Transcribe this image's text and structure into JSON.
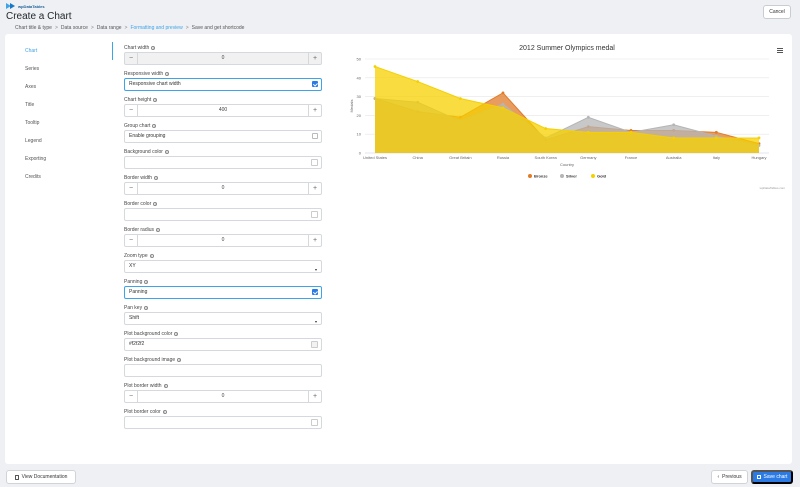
{
  "app": {
    "logo_text": "wpDataTables",
    "title": "Create a Chart",
    "cancel_label": "Cancel"
  },
  "breadcrumb": [
    {
      "label": "Chart title & type",
      "active": false
    },
    {
      "label": "Data source",
      "active": false
    },
    {
      "label": "Data range",
      "active": false
    },
    {
      "label": "Formatting and preview",
      "active": true
    },
    {
      "label": "Save and get shortcode",
      "active": false
    }
  ],
  "sidebar": {
    "items": [
      "Chart",
      "Series",
      "Axes",
      "Title",
      "Tooltip",
      "Legend",
      "Exporting",
      "Credits"
    ],
    "active_index": 0
  },
  "form": {
    "chart_width": {
      "label": "Chart width",
      "value": "0"
    },
    "responsive_width": {
      "label": "Responsive width",
      "text": "Responsive chart width",
      "checked": true
    },
    "chart_height": {
      "label": "Chart height",
      "value": "400"
    },
    "group_chart": {
      "label": "Group chart",
      "text": "Enable grouping",
      "checked": false
    },
    "background_color": {
      "label": "Background color",
      "value": ""
    },
    "border_width": {
      "label": "Border width",
      "value": "0"
    },
    "border_color": {
      "label": "Border color",
      "value": ""
    },
    "border_radius": {
      "label": "Border radius",
      "value": "0"
    },
    "zoom_type": {
      "label": "Zoom type",
      "value": "XY"
    },
    "panning": {
      "label": "Panning",
      "text": "Panning",
      "checked": true
    },
    "pan_key": {
      "label": "Pan key",
      "value": "Shift"
    },
    "plot_bg_color": {
      "label": "Plot background color",
      "value": "#f2f2f2"
    },
    "plot_bg_image": {
      "label": "Plot background image",
      "value": ""
    },
    "plot_border_width": {
      "label": "Plot border width",
      "value": "0"
    },
    "plot_border_color": {
      "label": "Plot border color",
      "value": ""
    }
  },
  "chart_data": {
    "type": "area",
    "title": "2012 Summer Olympics medal",
    "xlabel": "Country",
    "ylabel": "Medals",
    "categories": [
      "United States",
      "China",
      "Great Britain",
      "Russia",
      "South Korea",
      "Germany",
      "France",
      "Australia",
      "Italy",
      "Hungary"
    ],
    "ylim": [
      0,
      50
    ],
    "yticks": [
      0,
      10,
      20,
      30,
      40,
      50
    ],
    "series": [
      {
        "name": "Bronze",
        "color": "#e07b2a",
        "values": [
          29,
          22,
          19,
          32,
          7,
          14,
          12,
          12,
          11,
          5
        ]
      },
      {
        "name": "Silver",
        "color": "#b5b5b5",
        "values": [
          29,
          27,
          17,
          26,
          8,
          19,
          11,
          15,
          9,
          4
        ]
      },
      {
        "name": "Gold",
        "color": "#f5d000",
        "values": [
          46,
          38,
          29,
          24,
          13,
          11,
          11,
          8,
          8,
          8
        ]
      }
    ],
    "legend_position": "bottom",
    "grid": true,
    "credits": "wpDataTables.com"
  },
  "footer": {
    "doc_label": "View Documentation",
    "prev_label": "Previous",
    "save_label": "Save chart"
  }
}
